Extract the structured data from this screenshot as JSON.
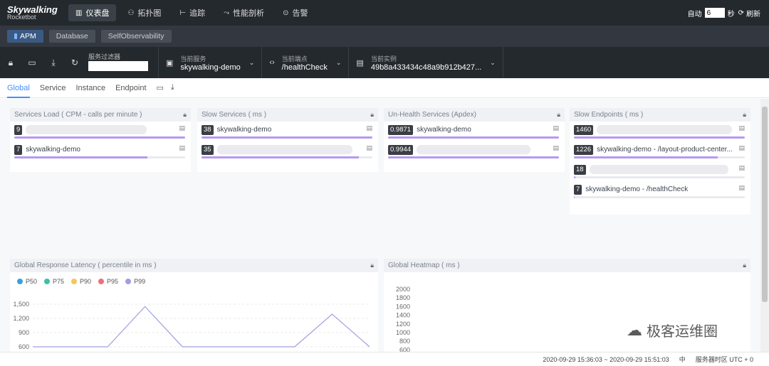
{
  "nav": {
    "logo_line1": "Skywalking",
    "logo_line2": "Rocketbot",
    "items": [
      {
        "label": "仪表盘",
        "icon": "dashboard-icon"
      },
      {
        "label": "拓扑图",
        "icon": "topology-icon"
      },
      {
        "label": "追踪",
        "icon": "trace-icon"
      },
      {
        "label": "性能剖析",
        "icon": "profile-icon"
      },
      {
        "label": "告警",
        "icon": "alarm-icon"
      }
    ],
    "auto_label": "自动",
    "auto_value": "6",
    "seconds_label": "秒",
    "refresh_label": "刷新"
  },
  "top_tabs": [
    "APM",
    "Database",
    "SelfObservability"
  ],
  "toolbar": {
    "filter_label": "服务过滤器",
    "service_label": "当前服务",
    "service_value": "skywalking-demo",
    "endpoint_label": "当前端点",
    "endpoint_value": "/healthCheck",
    "instance_label": "当前实例",
    "instance_value": "49b8a433434c48a9b912b427..."
  },
  "page_tabs": [
    "Global",
    "Service",
    "Instance",
    "Endpoint"
  ],
  "panels": {
    "services_load": {
      "title": "Services Load ( CPM - calls per minute )",
      "items": [
        {
          "value": "9",
          "name": "",
          "fill": 1.0
        },
        {
          "value": "7",
          "name": "skywalking-demo",
          "fill": 0.78
        }
      ]
    },
    "slow_services": {
      "title": "Slow Services ( ms )",
      "items": [
        {
          "value": "38",
          "name": "skywalking-demo",
          "fill": 1.0
        },
        {
          "value": "35",
          "name": "",
          "fill": 0.92
        }
      ]
    },
    "unhealth_services": {
      "title": "Un-Health Services (Apdex)",
      "items": [
        {
          "value": "0.9871",
          "name": "skywalking-demo",
          "fill": 1.0
        },
        {
          "value": "0.9944",
          "name": "",
          "fill": 1.0
        }
      ]
    },
    "slow_endpoints": {
      "title": "Slow Endpoints ( ms )",
      "items": [
        {
          "value": "1460",
          "name": "",
          "fill": 1.0
        },
        {
          "value": "1226",
          "name": "skywalking-demo - /layout-product-center...",
          "fill": 0.84
        },
        {
          "value": "18",
          "name": "",
          "fill": 0.01
        },
        {
          "value": "7",
          "name": "skywalking-demo - /healthCheck",
          "fill": 0.005
        }
      ]
    },
    "latency": {
      "title": "Global Response Latency ( percentile in ms )",
      "legend": [
        {
          "name": "P50",
          "color": "#3aa0e3"
        },
        {
          "name": "P75",
          "color": "#3fbfa8"
        },
        {
          "name": "P90",
          "color": "#f5c659"
        },
        {
          "name": "P95",
          "color": "#f26d7d"
        },
        {
          "name": "P99",
          "color": "#9f9fe0"
        }
      ],
      "y_ticks": [
        "1,500",
        "1,200",
        "900",
        "600"
      ]
    },
    "heatmap": {
      "title": "Global Heatmap ( ms )",
      "y_ticks": [
        "2000",
        "1800",
        "1600",
        "1400",
        "1200",
        "1000",
        "800",
        "600"
      ]
    }
  },
  "chart_data": {
    "type": "line",
    "ylim": [
      600,
      1500
    ],
    "series": [
      {
        "name": "P99",
        "values": [
          600,
          600,
          600,
          1450,
          600,
          600,
          600,
          600,
          1290,
          600
        ]
      }
    ]
  },
  "footer": {
    "time_range": "2020-09-29 15:36:03 ~ 2020-09-29 15:51:03",
    "lang": "中",
    "tz": "服务器时区 UTC + 0"
  },
  "watermark": "极客运维圈"
}
